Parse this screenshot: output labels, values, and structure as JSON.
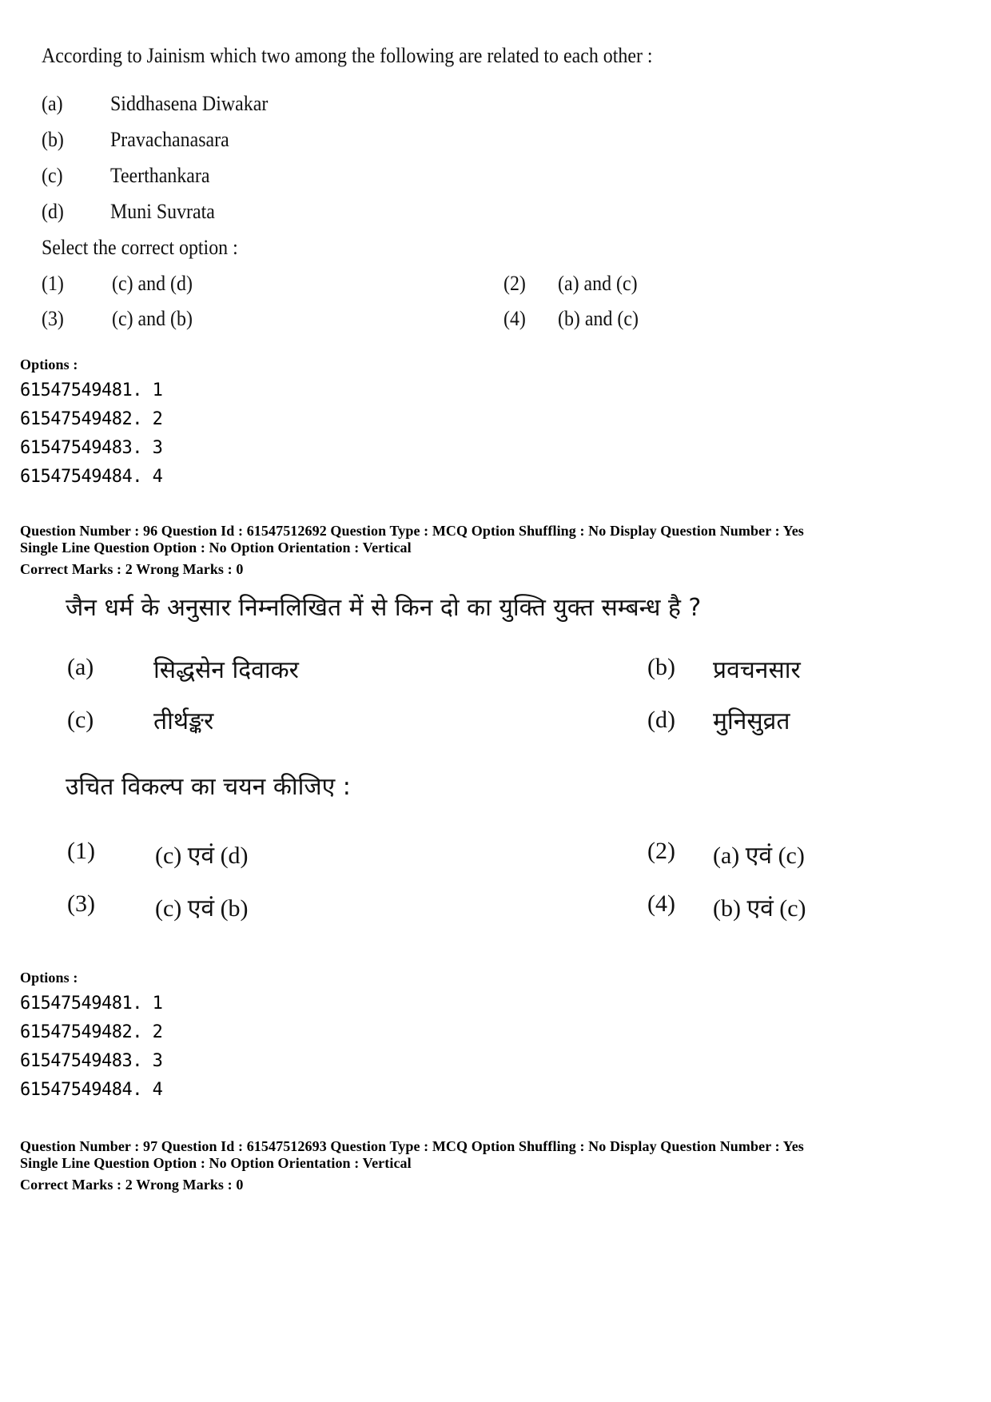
{
  "question_95_english": {
    "stem": "According to Jainism which two among the following are related to each other :",
    "items": [
      {
        "label": "(a)",
        "text": "Siddhasena Diwakar"
      },
      {
        "label": "(b)",
        "text": "Pravachanasara"
      },
      {
        "label": "(c)",
        "text": "Teerthankara"
      },
      {
        "label": "(d)",
        "text": "Muni Suvrata"
      }
    ],
    "prompt": "Select the correct option :",
    "choices": [
      {
        "label": "(1)",
        "text": "(c) and (d)"
      },
      {
        "label": "(2)",
        "text": "(a) and (c)"
      },
      {
        "label": "(3)",
        "text": "(c) and (b)"
      },
      {
        "label": "(4)",
        "text": "(b) and (c)"
      }
    ],
    "options_heading": "Options :",
    "options": [
      "61547549481. 1",
      "61547549482. 2",
      "61547549483. 3",
      "61547549484. 4"
    ]
  },
  "question_96": {
    "meta_line1": "Question Number : 96  Question Id : 61547512692  Question Type : MCQ  Option Shuffling : No  Display Question Number : Yes",
    "meta_line2": "Single Line Question Option : No  Option Orientation : Vertical",
    "marks": "Correct Marks : 2  Wrong Marks : 0",
    "stem": "जैन धर्म के अनुसार निम्नलिखित में से किन दो का युक्ति युक्त सम्बन्ध है ?",
    "items": [
      {
        "label": "(a)",
        "text": "सिद्धसेन दिवाकर"
      },
      {
        "label": "(b)",
        "text": "प्रवचनसार"
      },
      {
        "label": "(c)",
        "text": "तीर्थङ्कर"
      },
      {
        "label": "(d)",
        "text": "मुनिसुव्रत"
      }
    ],
    "prompt": "उचित विकल्प का चयन कीजिए :",
    "choices": [
      {
        "label": "(1)",
        "text": "(c) एवं (d)"
      },
      {
        "label": "(2)",
        "text": "(a) एवं (c)"
      },
      {
        "label": "(3)",
        "text": "(c) एवं (b)"
      },
      {
        "label": "(4)",
        "text": "(b) एवं (c)"
      }
    ],
    "options_heading": "Options :",
    "options": [
      "61547549481. 1",
      "61547549482. 2",
      "61547549483. 3",
      "61547549484. 4"
    ]
  },
  "question_97": {
    "meta_line1": "Question Number : 97  Question Id : 61547512693  Question Type : MCQ  Option Shuffling : No  Display Question Number : Yes",
    "meta_line2": "Single Line Question Option : No  Option Orientation : Vertical",
    "marks": "Correct Marks : 2  Wrong Marks : 0"
  }
}
